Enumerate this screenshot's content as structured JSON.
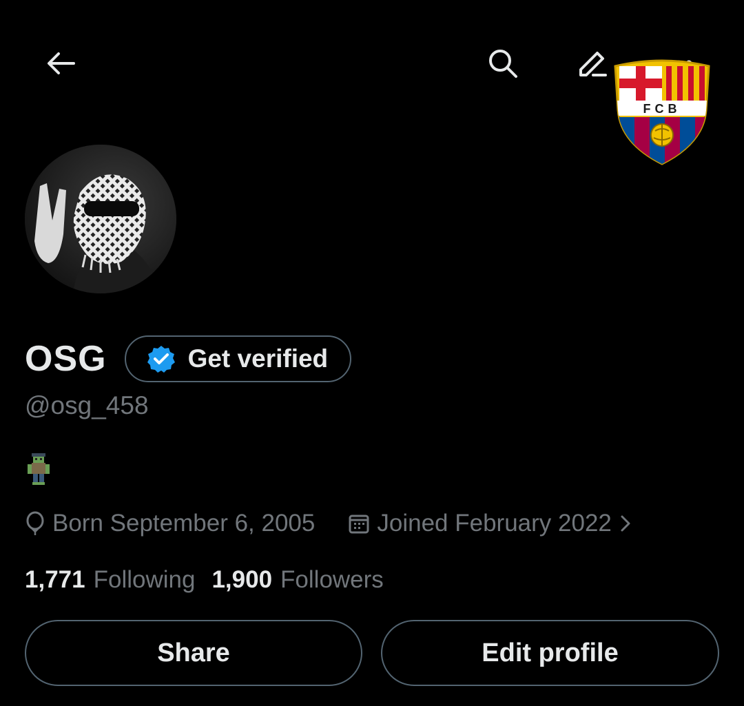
{
  "header": {
    "back_icon": "arrow-left-icon",
    "search_icon": "search-icon",
    "edit_icon": "pencil-icon",
    "more_icon": "more-dots-icon",
    "crest_text": "FCB"
  },
  "profile": {
    "display_name": "OSG",
    "verify_label": "Get verified",
    "handle": "@osg_458",
    "born": "Born September 6, 2005",
    "joined": "Joined February 2022",
    "following_count": "1,771",
    "following_label": "Following",
    "followers_count": "1,900",
    "followers_label": "Followers"
  },
  "actions": {
    "share_label": "Share",
    "edit_profile_label": "Edit profile"
  },
  "colors": {
    "background": "#000000",
    "primary_text": "#e7e9ea",
    "secondary_text": "#71767b",
    "border": "#536471",
    "verified_blue": "#1d9bf0"
  }
}
